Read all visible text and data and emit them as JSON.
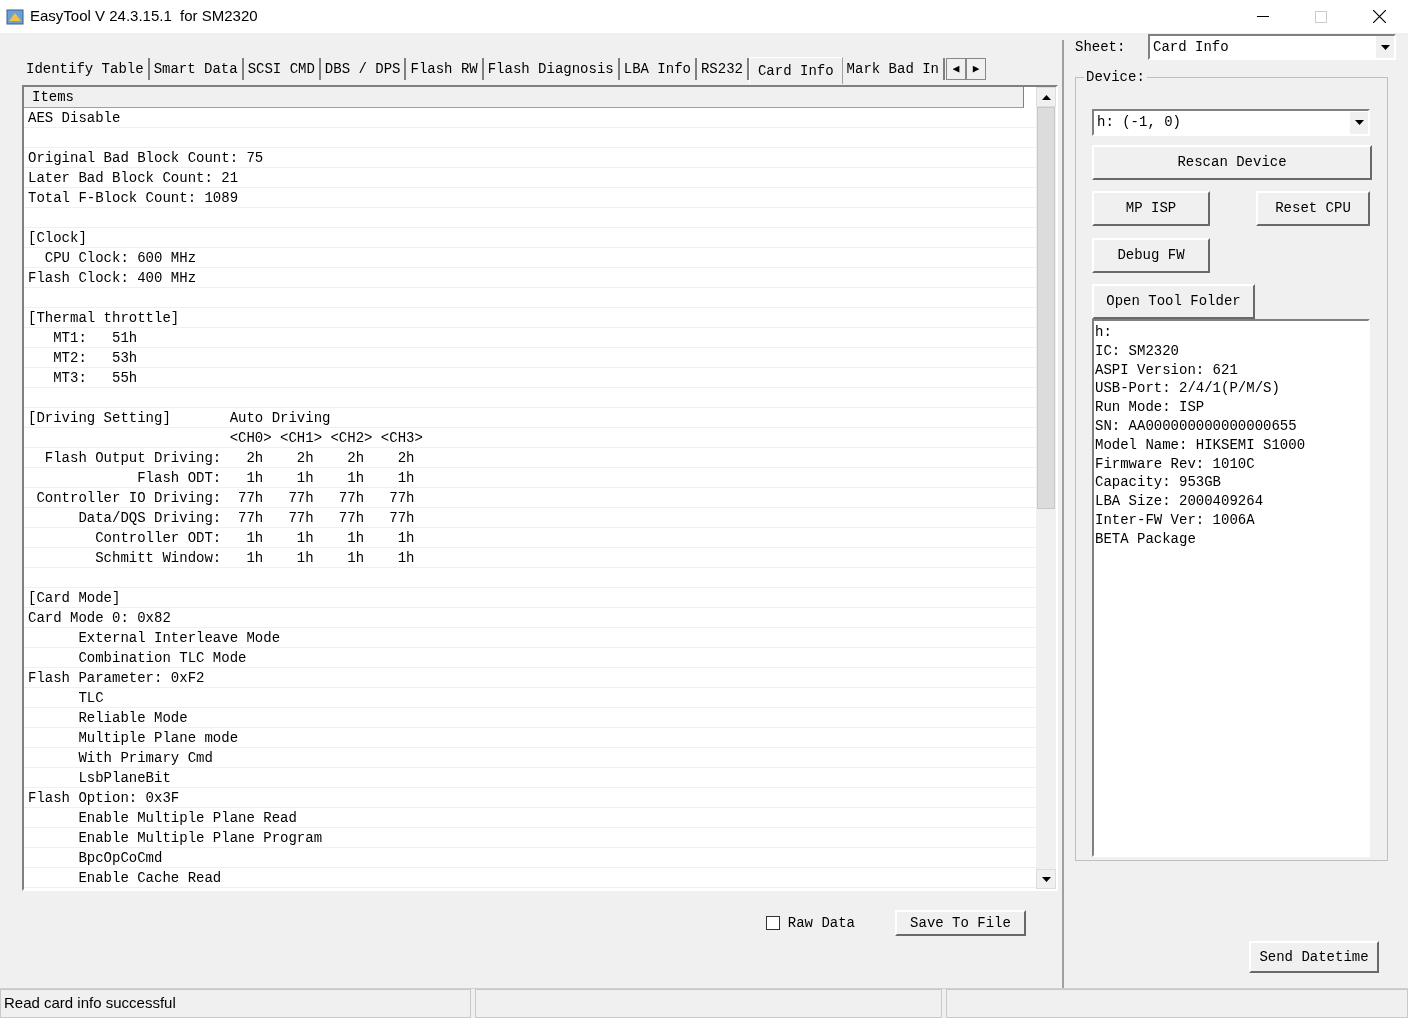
{
  "window": {
    "title": "EasyTool V 24.3.15.1  for SM2320"
  },
  "tabs": [
    {
      "label": "Identify Table",
      "selected": false
    },
    {
      "label": "Smart Data",
      "selected": false
    },
    {
      "label": "SCSI CMD",
      "selected": false
    },
    {
      "label": "DBS / DPS",
      "selected": false
    },
    {
      "label": "Flash RW",
      "selected": false
    },
    {
      "label": "Flash Diagnosis",
      "selected": false
    },
    {
      "label": "LBA Info",
      "selected": false
    },
    {
      "label": "RS232",
      "selected": false
    },
    {
      "label": "Card Info",
      "selected": true
    },
    {
      "label": "Mark Bad In",
      "selected": false
    }
  ],
  "tab_scroll": {
    "left": "◀",
    "right": "▶"
  },
  "items": {
    "header": "Items",
    "groups": [
      [
        "AES Disable"
      ],
      [
        "Original Bad Block Count: 75",
        "Later Bad Block Count: 21",
        "Total F-Block Count: 1089"
      ],
      [
        "[Clock]",
        "  CPU Clock: 600 MHz",
        "Flash Clock: 400 MHz"
      ],
      [
        "[Thermal throttle]",
        "   MT1:   51h",
        "   MT2:   53h",
        "   MT3:   55h"
      ],
      [
        "[Driving Setting]       Auto Driving",
        "                        <CH0> <CH1> <CH2> <CH3>",
        "  Flash Output Driving:   2h    2h    2h    2h",
        "             Flash ODT:   1h    1h    1h    1h",
        " Controller IO Driving:  77h   77h   77h   77h",
        "      Data/DQS Driving:  77h   77h   77h   77h",
        "        Controller ODT:   1h    1h    1h    1h",
        "        Schmitt Window:   1h    1h    1h    1h"
      ],
      [
        "[Card Mode]",
        "Card Mode 0: 0x82",
        "      External Interleave Mode",
        "      Combination TLC Mode",
        "Flash Parameter: 0xF2",
        "      TLC",
        "      Reliable Mode",
        "      Multiple Plane mode",
        "      With Primary Cmd",
        "      LsbPlaneBit",
        "Flash Option: 0x3F",
        "      Enable Multiple Plane Read",
        "      Enable Multiple Plane Program",
        "      BpcOpCoCmd",
        "      Enable Cache Read"
      ]
    ]
  },
  "raw_data": {
    "label": "Raw Data",
    "checked": false
  },
  "save_button": "Save To File",
  "sheet": {
    "label": "Sheet:",
    "value": "Card Info"
  },
  "device": {
    "label": "Device:",
    "value": "h: (-1, 0)",
    "buttons": {
      "rescan": "Rescan Device",
      "mp_isp": "MP ISP",
      "reset_cpu": "Reset CPU",
      "debug_fw": "Debug FW",
      "open_folder": "Open Tool Folder"
    },
    "info": [
      "h:",
      "IC: SM2320",
      "ASPI Version: 621",
      "USB-Port: 2/4/1(P/M/S)",
      "Run Mode: ISP",
      "SN: AA000000000000000655",
      "Model Name: HIKSEMI S1000",
      "Firmware Rev: 1010C",
      "Capacity: 953GB",
      "LBA Size: 2000409264",
      "Inter-FW Ver: 1006A",
      "BETA Package"
    ]
  },
  "send_button": "Send Datetime",
  "status_bar": {
    "text": "Read card info successful"
  }
}
